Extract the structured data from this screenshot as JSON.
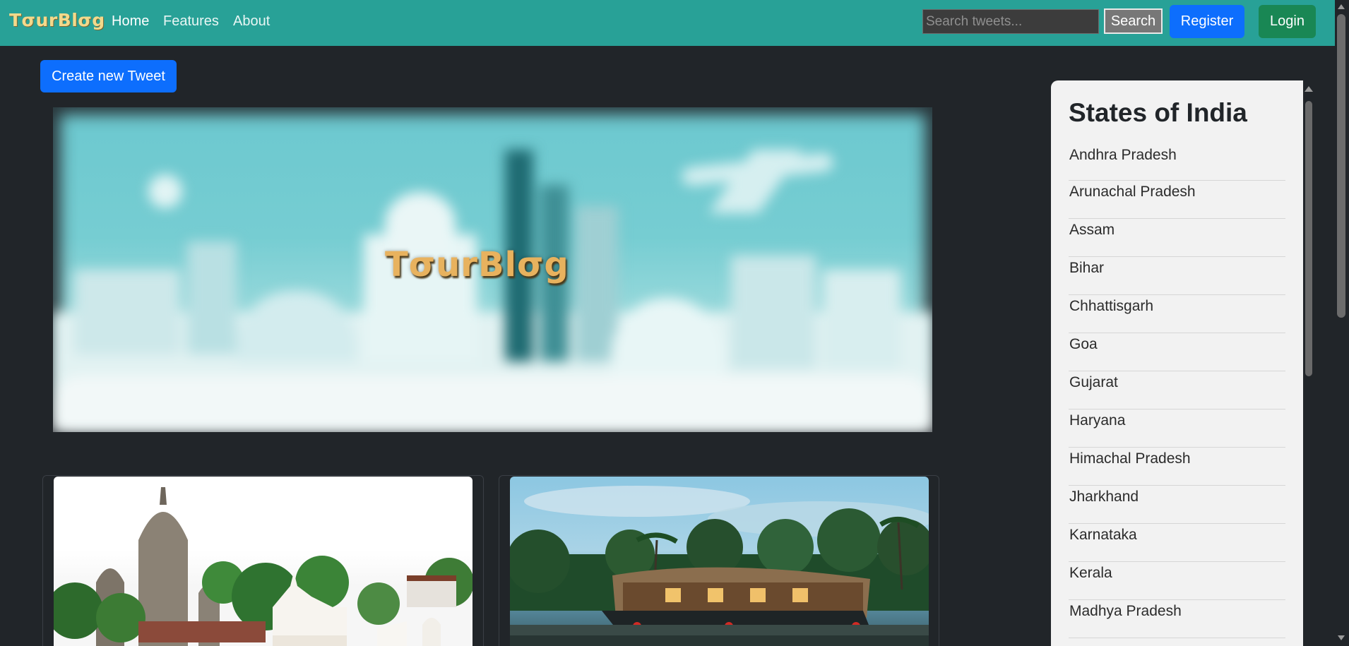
{
  "navbar": {
    "brand": "TσurBlσg",
    "links": [
      "Home",
      "Features",
      "About"
    ],
    "search_placeholder": "Search tweets...",
    "search_label": "Search",
    "register_label": "Register",
    "login_label": "Login",
    "bg_color": "#28a197"
  },
  "main": {
    "create_label": "Create new Tweet",
    "hero_title": "TσurBlσg"
  },
  "sidebar": {
    "title": "States of India",
    "states": [
      "Andhra Pradesh",
      "Arunachal Pradesh",
      "Assam",
      "Bihar",
      "Chhattisgarh",
      "Goa",
      "Gujarat",
      "Haryana",
      "Himachal Pradesh",
      "Jharkhand",
      "Karnataka",
      "Kerala",
      "Madhya Pradesh"
    ]
  }
}
